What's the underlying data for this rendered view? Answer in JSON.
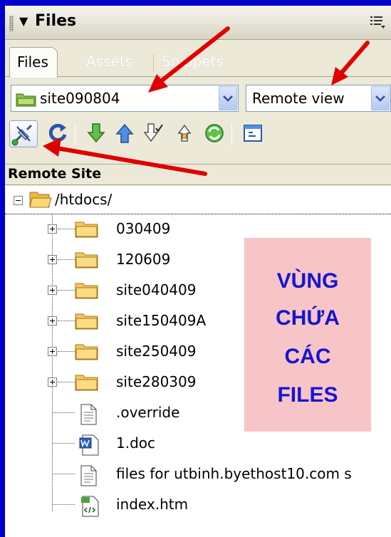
{
  "panel": {
    "title": "Files",
    "collapse_glyph": "▼"
  },
  "tabs": [
    {
      "label": "Files",
      "active": true
    },
    {
      "label": "Assets",
      "active": false
    },
    {
      "label": "Snippets",
      "active": false
    }
  ],
  "site_select": {
    "value": "site090804",
    "icon": "site-folder-icon"
  },
  "view_select": {
    "value": "Remote view"
  },
  "toolbar": {
    "buttons": [
      "connect-icon",
      "refresh-icon",
      "get-down-arrow-icon",
      "put-up-arrow-icon",
      "check-out-icon",
      "check-in-icon",
      "synchronize-icon",
      "expand-view-icon"
    ]
  },
  "column_header": {
    "label": "Remote Site"
  },
  "tree": {
    "root": {
      "label": "/htdocs/",
      "expanded": true
    },
    "items": [
      {
        "label": "030409",
        "type": "folder"
      },
      {
        "label": "120609",
        "type": "folder"
      },
      {
        "label": "site040409",
        "type": "folder"
      },
      {
        "label": "site150409A",
        "type": "folder"
      },
      {
        "label": "site250409",
        "type": "folder"
      },
      {
        "label": "site280309",
        "type": "folder"
      },
      {
        "label": ".override",
        "type": "file"
      },
      {
        "label": "1.doc",
        "type": "word"
      },
      {
        "label": "files for utbinh.byethost10.com s",
        "type": "file"
      },
      {
        "label": "index.htm",
        "type": "html"
      }
    ]
  },
  "note": {
    "lines": [
      "VÙNG",
      "CHỨA",
      "CÁC",
      "FILES"
    ],
    "background": "#f7c5c7",
    "text_color": "#1515d0"
  },
  "colors": {
    "border": "#0000cc",
    "arrow": "#e00000",
    "panel_bg": "#ece9d8"
  }
}
